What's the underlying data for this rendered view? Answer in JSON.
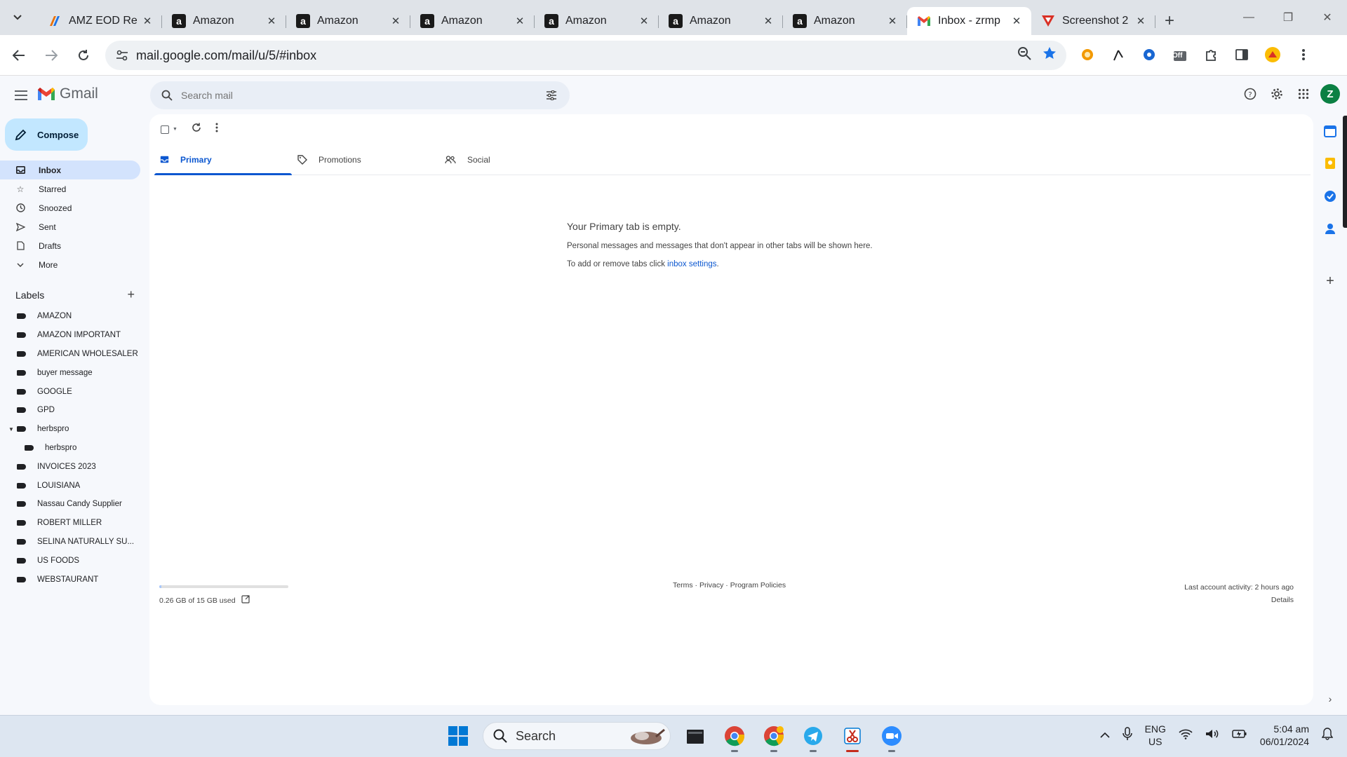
{
  "browser": {
    "tabs": [
      {
        "title": "AMZ EOD Re",
        "favicon": "sheets-like-icon",
        "active": false
      },
      {
        "title": "Amazon",
        "favicon": "amazon-icon",
        "active": false
      },
      {
        "title": "Amazon",
        "favicon": "amazon-icon",
        "active": false
      },
      {
        "title": "Amazon",
        "favicon": "amazon-icon",
        "active": false
      },
      {
        "title": "Amazon",
        "favicon": "amazon-icon",
        "active": false
      },
      {
        "title": "Amazon",
        "favicon": "amazon-icon",
        "active": false
      },
      {
        "title": "Amazon",
        "favicon": "amazon-icon",
        "active": false
      },
      {
        "title": "Inbox - zrmp",
        "favicon": "gmail-icon",
        "active": true
      },
      {
        "title": "Screenshot 2",
        "favicon": "screenshot-icon",
        "active": false
      }
    ],
    "url": "mail.google.com/mail/u/5/#inbox",
    "extension_badge": "Off"
  },
  "gmail": {
    "app_name": "Gmail",
    "search_placeholder": "Search mail",
    "avatar_letter": "Z",
    "compose_label": "Compose",
    "nav": [
      {
        "label": "Inbox",
        "icon": "inbox-icon",
        "active": true
      },
      {
        "label": "Starred",
        "icon": "star-icon"
      },
      {
        "label": "Snoozed",
        "icon": "clock-icon"
      },
      {
        "label": "Sent",
        "icon": "send-icon"
      },
      {
        "label": "Drafts",
        "icon": "draft-icon"
      },
      {
        "label": "More",
        "icon": "chevron-down-icon"
      }
    ],
    "labels_title": "Labels",
    "labels": [
      {
        "label": "AMAZON"
      },
      {
        "label": "AMAZON IMPORTANT"
      },
      {
        "label": "AMERICAN WHOLESALER"
      },
      {
        "label": "buyer message"
      },
      {
        "label": "GOOGLE"
      },
      {
        "label": "GPD"
      },
      {
        "label": "herbspro",
        "expanded": true
      },
      {
        "label": "herbspro",
        "sub": true
      },
      {
        "label": "INVOICES 2023"
      },
      {
        "label": "LOUISIANA"
      },
      {
        "label": "Nassau Candy Supplier"
      },
      {
        "label": "ROBERT MILLER"
      },
      {
        "label": "SELINA NATURALLY SU..."
      },
      {
        "label": "US FOODS"
      },
      {
        "label": "WEBSTAURANT"
      }
    ],
    "category_tabs": [
      {
        "label": "Primary",
        "icon": "inbox-icon",
        "active": true
      },
      {
        "label": "Promotions",
        "icon": "tag-icon"
      },
      {
        "label": "Social",
        "icon": "people-icon"
      }
    ],
    "empty_state": {
      "title": "Your Primary tab is empty.",
      "line1": "Personal messages and messages that don't appear in other tabs will be shown here.",
      "line2_prefix": "To add or remove tabs click ",
      "line2_link": "inbox settings",
      "line2_suffix": "."
    },
    "storage": {
      "text": "0.26 GB of 15 GB used",
      "used_fraction": 0.017
    },
    "footer": {
      "terms": "Terms",
      "privacy": "Privacy",
      "program_policies": "Program Policies",
      "sep": " · ",
      "last_activity": "Last account activity: 2 hours ago",
      "details": "Details"
    }
  },
  "taskbar": {
    "search_label": "Search",
    "lang_line1": "ENG",
    "lang_line2": "US",
    "time": "5:04 am",
    "date": "06/01/2024"
  },
  "colors": {
    "accent": "#0b57d0",
    "compose_bg": "#c2e7ff",
    "active_nav_bg": "#d3e3fd"
  }
}
